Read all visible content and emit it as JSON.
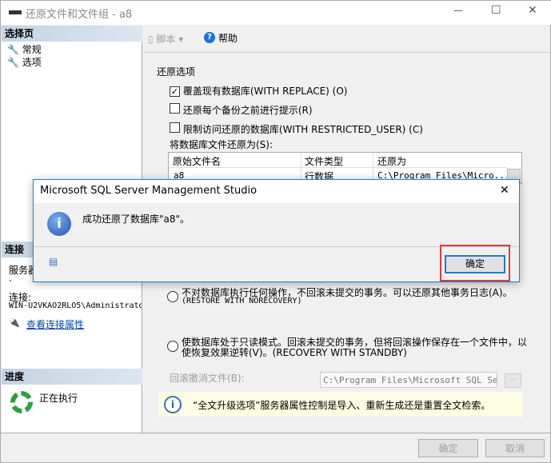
{
  "window": {
    "title": "还原文件和文件组 - a8",
    "minimize": "—",
    "maximize": "☐",
    "close": "✕"
  },
  "sidebar": {
    "select_header": "选择页",
    "items": [
      {
        "label": "常规"
      },
      {
        "label": "选项"
      }
    ],
    "connection_header": "连接",
    "server_label": "服务器",
    "server_value": ".",
    "connection_label": "连接:",
    "connection_value": "WIN-U2VKAO2RLO5\\Administrator",
    "view_props_link": "查看连接属性",
    "progress_header": "进度",
    "progress_status": "正在执行"
  },
  "toolbar": {
    "script_label": "脚本",
    "help_label": "帮助"
  },
  "options": {
    "section_title": "还原选项",
    "checkboxes": [
      {
        "label": "覆盖现有数据库(WITH REPLACE) (O)",
        "checked": true
      },
      {
        "label": "还原每个备份之前进行提示(R)",
        "checked": false
      },
      {
        "label": "限制访问还原的数据库(WITH RESTRICTED_USER) (C)",
        "checked": false
      }
    ],
    "files_label": "将数据库文件还原为(S):",
    "table": {
      "columns": [
        "原始文件名",
        "文件类型",
        "还原为"
      ],
      "rows": [
        [
          "a8",
          "行数据",
          "C:\\Program Files\\Micro..."
        ]
      ]
    },
    "radios": [
      {
        "line1": "不对数据库执行任何操作，不回滚未提交的事务。可以还原其他事务日志(A)。",
        "line2": "(RESTORE WITH NORECOVERY)"
      },
      {
        "line1": "使数据库处于只读模式。回滚未提交的事务，但将回滚操作保存在一个文件中，以",
        "line2": "使恢复效果逆转(V)。(RECOVERY WITH STANDBY)"
      }
    ],
    "rollback_label": "回滚撤消文件(B):",
    "rollback_value": "C:\\Program Files\\Microsoft SQL Serve",
    "browse_label": "...",
    "info_text": "“全文升级选项”服务器属性控制是导入、重新生成还是重置全文检索。"
  },
  "footer": {
    "ok": "确定",
    "cancel": "取消"
  },
  "dialog": {
    "title": "Microsoft SQL Server Management Studio",
    "message": "成功还原了数据库\"a8\"。",
    "ok": "确定",
    "close": "✕",
    "highlight_color": "#e8383d"
  }
}
